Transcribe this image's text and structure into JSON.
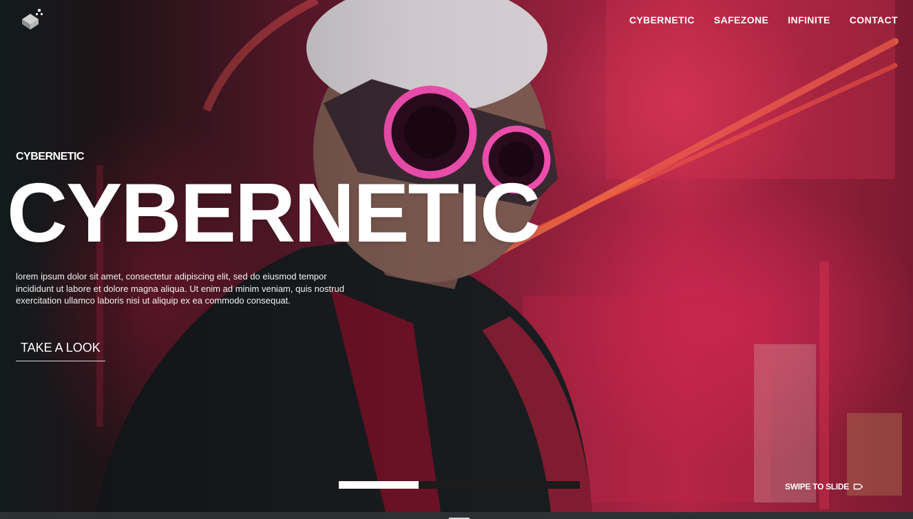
{
  "nav": {
    "items": [
      {
        "label": "CYBERNETIC"
      },
      {
        "label": "SAFEZONE"
      },
      {
        "label": "INFINITE"
      },
      {
        "label": "CONTACT"
      }
    ]
  },
  "hero": {
    "eyebrow": "CYBERNETIC",
    "headline": "CYBERNETIC",
    "description": "lorem ipsum dolor sit amet, consectetur adipiscing elit, sed do eiusmod tempor incididunt ut labore et dolore magna aliqua. Ut enim ad minim veniam, quis nostrud exercitation ullamco laboris nisi ut aliquip ex ea commodo consequat.",
    "cta_label": "TAKE A LOOK"
  },
  "slider": {
    "progress_fraction": 0.33,
    "swipe_label": "SWIPE TO SLIDE"
  },
  "icons": {
    "logo": "cube-logo-icon",
    "swipe": "arrow-right-outline-icon"
  },
  "colors": {
    "accent_pink": "#e43a86",
    "text": "#ffffff",
    "progress_track": "#1b1b1b"
  }
}
